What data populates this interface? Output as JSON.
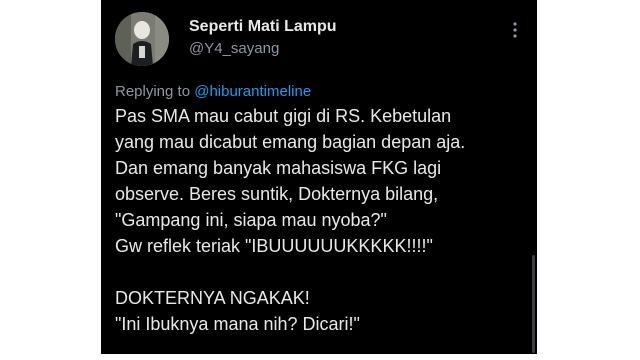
{
  "post": {
    "author": {
      "display_name": "Seperti Mati Lampu",
      "handle": "@Y4_sayang"
    },
    "menu_icon": "more-vertical-icon",
    "replying_to": {
      "prefix": "Replying to",
      "mention": "@hiburantimeline"
    },
    "lines": [
      "Pas SMA mau cabut gigi di RS. Kebetulan",
      "yang mau dicabut emang bagian depan aja.",
      "Dan emang banyak mahasiswa FKG lagi",
      "observe. Beres suntik, Dokternya bilang,",
      "\"Gampang ini, siapa mau nyoba?\"",
      "Gw reflek teriak \"IBUUUUUUKKKKK!!!!\"",
      "",
      "DOKTERNYA NGAKAK!",
      "\"Ini Ibuknya mana nih? Dicari!\""
    ]
  },
  "colors": {
    "background": "#000000",
    "text_primary": "#e7e9ea",
    "text_secondary": "#8b98a5",
    "accent": "#1d9bf0"
  }
}
